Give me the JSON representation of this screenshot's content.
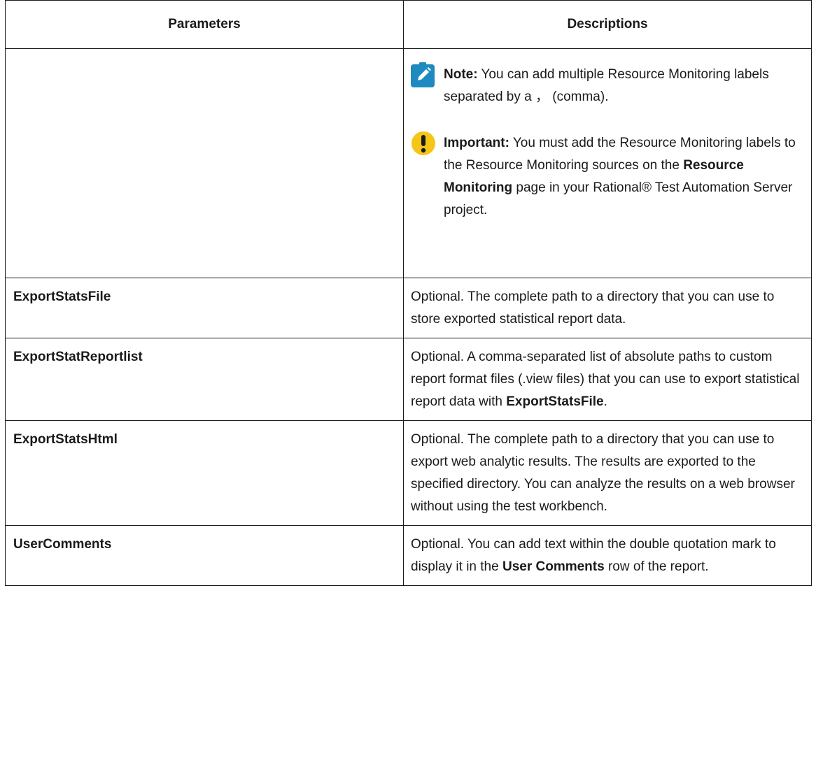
{
  "table": {
    "headers": [
      "Parameters",
      "Descriptions"
    ],
    "note": {
      "label": "Note:",
      "text": " You can add multiple Resource Moni­toring labels separated by a ， (comma)."
    },
    "important": {
      "label": "Important:",
      "text_1": " You must add the Resource Mon­itoring labels to the Resource Monitoring sources on the ",
      "bold_1": "Resource Monitoring",
      "text_2": " page in your Rational® Test Automation Server project."
    },
    "rows": [
      {
        "param": "ExportStatsFile",
        "desc": "Optional. The complete path to a directory that you can use to store exported statistical report data."
      },
      {
        "param": "ExportStatReportlist",
        "desc_1": "Optional. A comma-separated list of absolute paths to custom report format files (.view files) that you can use to export statistical report data with ",
        "desc_bold": "Export­StatsFile",
        "desc_2": "."
      },
      {
        "param": "ExportStatsHtml",
        "desc": "Optional. The complete path to a directory that you can use to export web analytic results. The results are exported to the specified directory. You can ana­lyze the results on a web browser without using the test workbench."
      },
      {
        "param": "UserComments",
        "desc_1": "Optional. You can add text within the double quota­tion mark to display it in the ",
        "desc_bold": "User Comments",
        "desc_2": " row of the report."
      }
    ]
  },
  "colors": {
    "note_icon": "#1f8ac0",
    "important_icon": "#f5c518",
    "border": "#1a1a1a"
  },
  "icons": [
    "note-pencil-icon",
    "important-exclamation-icon"
  ]
}
